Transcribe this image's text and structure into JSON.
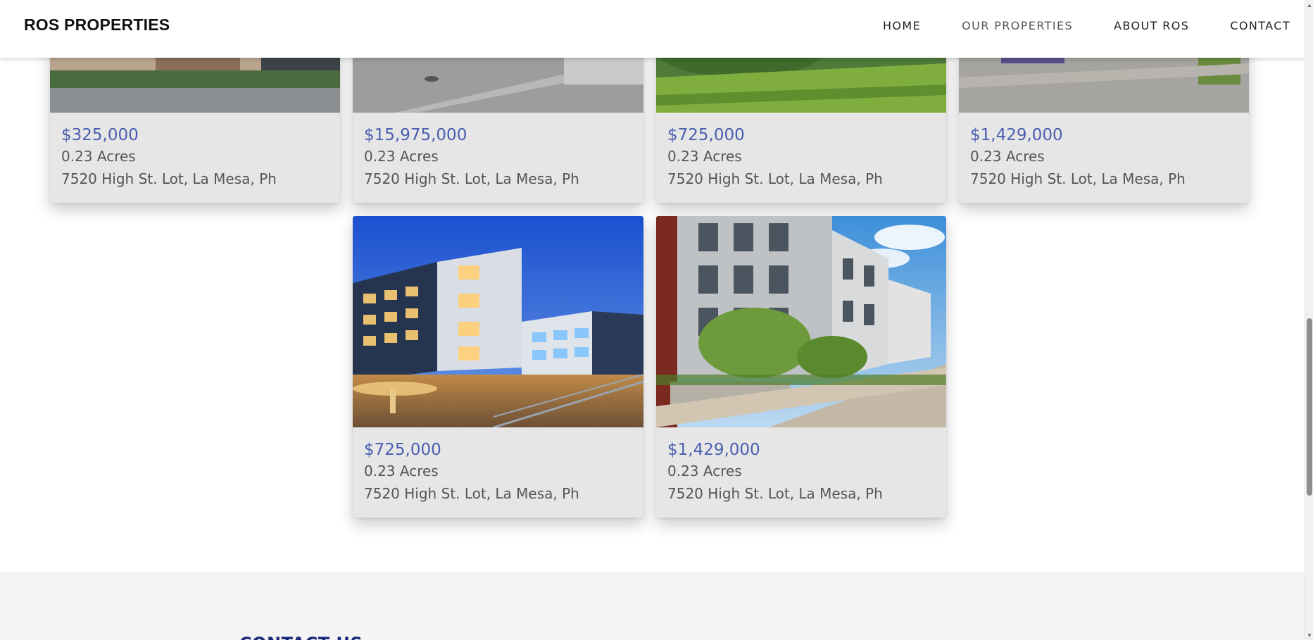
{
  "header": {
    "brand": "ROS PROPERTIES",
    "nav": [
      {
        "label": "HOME"
      },
      {
        "label": "OUR PROPERTIES"
      },
      {
        "label": "ABOUT ROS"
      },
      {
        "label": "CONTACT"
      }
    ]
  },
  "listings": [
    {
      "price": "$325,000",
      "acres": "0.23 Acres",
      "address": "7520 High St. Lot, La Mesa, Ph"
    },
    {
      "price": "$15,975,000",
      "acres": "0.23 Acres",
      "address": "7520 High St. Lot, La Mesa, Ph"
    },
    {
      "price": "$725,000",
      "acres": "0.23 Acres",
      "address": "7520 High St. Lot, La Mesa, Ph"
    },
    {
      "price": "$1,429,000",
      "acres": "0.23 Acres",
      "address": "7520 High St. Lot, La Mesa, Ph"
    },
    {
      "price": "$725,000",
      "acres": "0.23 Acres",
      "address": "7520 High St. Lot, La Mesa, Ph"
    },
    {
      "price": "$1,429,000",
      "acres": "0.23 Acres",
      "address": "7520 High St. Lot, La Mesa, Ph"
    }
  ],
  "footer": {
    "contact_heading": "CONTACT US"
  },
  "colors": {
    "price": "#4a5fb0",
    "card_bg": "#e6e6e6",
    "contact_heading": "#1a2a7a"
  }
}
